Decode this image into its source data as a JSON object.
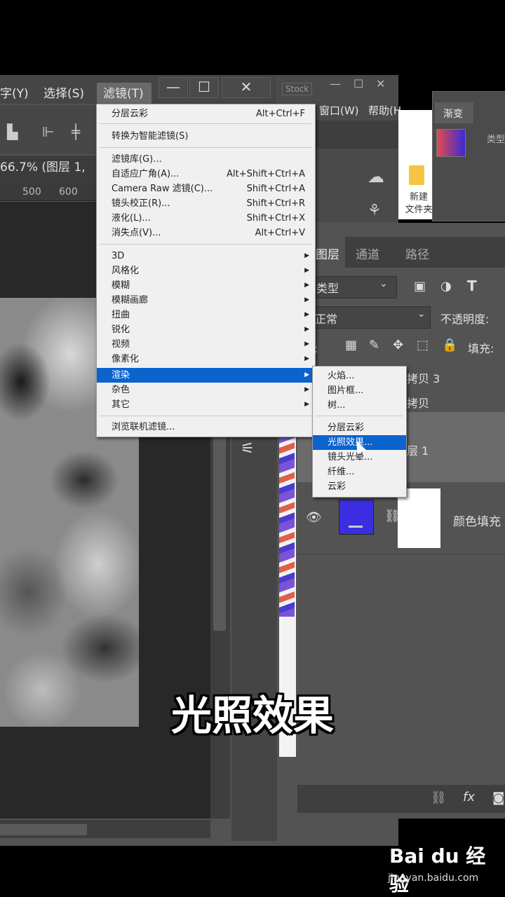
{
  "menubar": {
    "items": [
      "字(Y)",
      "选择(S)",
      "滤镜(T)"
    ]
  },
  "window_controls": {
    "minimize": "—",
    "maximize": "☐",
    "close": "✕"
  },
  "document": {
    "tab": "66.7% (图层 1,",
    "ruler_ticks": [
      "500",
      "600"
    ]
  },
  "stock_window": {
    "title": "Stock",
    "menus": [
      "窗口(W)",
      "帮助(H"
    ]
  },
  "explorer": {
    "folder_label": "新建\n文件夹"
  },
  "gradient_panel": {
    "tab": "渐变",
    "label": "类型"
  },
  "layers_panel": {
    "tabs": [
      "图层",
      "通道",
      "路径"
    ],
    "filter_label": "类型",
    "blend_mode": "正常",
    "opacity_label": "不透明度:",
    "lock_label": "定:",
    "fill_label": "填充:",
    "layers": [
      {
        "name": "拷贝 3"
      },
      {
        "name": "拷贝"
      },
      {
        "name": "层 1"
      },
      {
        "name": "颜色填充"
      }
    ],
    "fill_color": "#3a2ee0"
  },
  "filter_menu": {
    "items": [
      {
        "label": "分层云彩",
        "shortcut": "Alt+Ctrl+F"
      },
      {
        "label": "转换为智能滤镜(S)",
        "shortcut": ""
      },
      {
        "label": "滤镜库(G)...",
        "shortcut": ""
      },
      {
        "label": "自适应广角(A)...",
        "shortcut": "Alt+Shift+Ctrl+A"
      },
      {
        "label": "Camera Raw 滤镜(C)...",
        "shortcut": "Shift+Ctrl+A"
      },
      {
        "label": "镜头校正(R)...",
        "shortcut": "Shift+Ctrl+R"
      },
      {
        "label": "液化(L)...",
        "shortcut": "Shift+Ctrl+X"
      },
      {
        "label": "消失点(V)...",
        "shortcut": "Alt+Ctrl+V"
      },
      {
        "label": "3D",
        "shortcut": ""
      },
      {
        "label": "风格化",
        "shortcut": ""
      },
      {
        "label": "模糊",
        "shortcut": ""
      },
      {
        "label": "模糊画廊",
        "shortcut": ""
      },
      {
        "label": "扭曲",
        "shortcut": ""
      },
      {
        "label": "锐化",
        "shortcut": ""
      },
      {
        "label": "视频",
        "shortcut": ""
      },
      {
        "label": "像素化",
        "shortcut": ""
      },
      {
        "label": "渲染",
        "shortcut": ""
      },
      {
        "label": "杂色",
        "shortcut": ""
      },
      {
        "label": "其它",
        "shortcut": ""
      },
      {
        "label": "浏览联机滤镜...",
        "shortcut": ""
      }
    ]
  },
  "render_submenu": {
    "items": [
      "火焰...",
      "图片框...",
      "树...",
      "分层云彩",
      "光照效果...",
      "镜头光晕...",
      "纤维...",
      "云彩"
    ]
  },
  "caption": "光照效果",
  "watermark": {
    "logo": "Bai du 经验",
    "url": "jingyan.baidu.com"
  },
  "colors": {
    "menu_highlight": "#0b63ce"
  }
}
